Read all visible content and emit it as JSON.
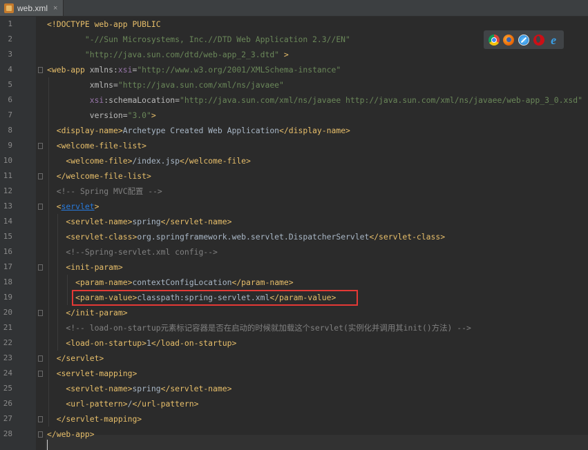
{
  "tab": {
    "label": "web.xml",
    "close": "×"
  },
  "browser_icons": [
    "chrome-icon",
    "firefox-icon",
    "safari-icon",
    "opera-icon",
    "ie-icon"
  ],
  "lines": [
    {
      "n": "1",
      "segs": [
        [
          "tag",
          "<!DOCTYPE web-app PUBLIC"
        ]
      ]
    },
    {
      "n": "2",
      "segs": [
        [
          "val",
          "        \"-//Sun Microsystems, Inc.//DTD Web Application 2.3//EN\""
        ]
      ]
    },
    {
      "n": "3",
      "segs": [
        [
          "val",
          "        \"http://java.sun.com/dtd/web-app_2_3.dtd\""
        ],
        [
          "tag",
          " >"
        ]
      ]
    },
    {
      "n": "4",
      "segs": [
        [
          "tag",
          "<web-app "
        ],
        [
          "attr",
          "xmlns:"
        ],
        [
          "ns",
          "xsi"
        ],
        [
          "attr",
          "="
        ],
        [
          "val",
          "\"http://www.w3.org/2001/XMLSchema-instance\""
        ]
      ]
    },
    {
      "n": "5",
      "segs": [
        [
          "attr",
          "         xmlns="
        ],
        [
          "val",
          "\"http://java.sun.com/xml/ns/javaee\""
        ]
      ]
    },
    {
      "n": "6",
      "segs": [
        [
          "ns",
          "         xsi"
        ],
        [
          "attr",
          ":schemaLocation="
        ],
        [
          "val",
          "\"http://java.sun.com/xml/ns/javaee http://java.sun.com/xml/ns/javaee/web-app_3_0.xsd\""
        ]
      ]
    },
    {
      "n": "7",
      "segs": [
        [
          "attr",
          "         version="
        ],
        [
          "val",
          "\"3.0\""
        ],
        [
          "tag",
          ">"
        ]
      ]
    },
    {
      "n": "8",
      "segs": [
        [
          "tag",
          "  <display-name>"
        ],
        [
          "plain",
          "Archetype Created Web Application"
        ],
        [
          "tag",
          "</display-name>"
        ]
      ]
    },
    {
      "n": "9",
      "segs": [
        [
          "tag",
          "  <welcome-file-list>"
        ]
      ]
    },
    {
      "n": "10",
      "segs": [
        [
          "tag",
          "    <welcome-file>"
        ],
        [
          "plain",
          "/index.jsp"
        ],
        [
          "tag",
          "</welcome-file>"
        ]
      ]
    },
    {
      "n": "11",
      "segs": [
        [
          "tag",
          "  </welcome-file-list>"
        ]
      ]
    },
    {
      "n": "12",
      "segs": [
        [
          "cm",
          "  <!-- Spring MVC配置 -->"
        ]
      ]
    },
    {
      "n": "13",
      "segs": [
        [
          "tag",
          "  <"
        ],
        [
          "link",
          "servlet"
        ],
        [
          "tag",
          ">"
        ]
      ]
    },
    {
      "n": "14",
      "segs": [
        [
          "tag",
          "    <servlet-name>"
        ],
        [
          "plain",
          "spring"
        ],
        [
          "tag",
          "</servlet-name>"
        ]
      ]
    },
    {
      "n": "15",
      "segs": [
        [
          "tag",
          "    <servlet-class>"
        ],
        [
          "plain",
          "org.springframework.web.servlet.DispatcherServlet"
        ],
        [
          "tag",
          "</servlet-class>"
        ]
      ]
    },
    {
      "n": "16",
      "segs": [
        [
          "cm",
          "    <!--Spring-servlet.xml config-->"
        ]
      ]
    },
    {
      "n": "17",
      "segs": [
        [
          "tag",
          "    <init-param>"
        ]
      ]
    },
    {
      "n": "18",
      "segs": [
        [
          "tag",
          "      <param-name>"
        ],
        [
          "plain",
          "contextConfigLocation"
        ],
        [
          "tag",
          "</param-name>"
        ]
      ]
    },
    {
      "n": "19",
      "segs": [
        [
          "tag",
          "      <param-value>"
        ],
        [
          "plain",
          "classpath:spring-servlet.xml"
        ],
        [
          "tag",
          "</param-value>"
        ]
      ]
    },
    {
      "n": "20",
      "segs": [
        [
          "tag",
          "    </init-param>"
        ]
      ]
    },
    {
      "n": "21",
      "segs": [
        [
          "cm",
          "    <!-- load-on-startup元素标记容器是否在启动的时候就加载这个servlet(实例化并调用其init()方法) -->"
        ]
      ]
    },
    {
      "n": "22",
      "segs": [
        [
          "tag",
          "    <load-on-startup>"
        ],
        [
          "plain",
          "1"
        ],
        [
          "tag",
          "</load-on-startup>"
        ]
      ]
    },
    {
      "n": "23",
      "segs": [
        [
          "tag",
          "  </servlet>"
        ]
      ]
    },
    {
      "n": "24",
      "segs": [
        [
          "tag",
          "  <servlet-mapping>"
        ]
      ]
    },
    {
      "n": "25",
      "segs": [
        [
          "tag",
          "    <servlet-name>"
        ],
        [
          "plain",
          "spring"
        ],
        [
          "tag",
          "</servlet-name>"
        ]
      ]
    },
    {
      "n": "26",
      "segs": [
        [
          "tag",
          "    <url-pattern>"
        ],
        [
          "plain",
          "/"
        ],
        [
          "tag",
          "</url-pattern>"
        ]
      ]
    },
    {
      "n": "27",
      "segs": [
        [
          "tag",
          "  </servlet-mapping>"
        ]
      ]
    },
    {
      "n": "28",
      "segs": [
        [
          "tag",
          "</web-app>"
        ]
      ]
    }
  ],
  "fold_lines": [
    "4",
    "9",
    "11",
    "13",
    "17",
    "20",
    "23",
    "24",
    "27",
    "28"
  ]
}
